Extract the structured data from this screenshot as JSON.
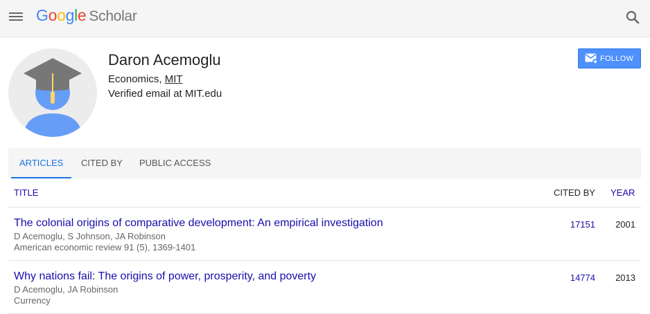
{
  "header": {
    "logo_letters": [
      "G",
      "o",
      "o",
      "g",
      "l",
      "e"
    ],
    "product": "Scholar",
    "menu_icon": "hamburger-menu-icon",
    "search_icon": "search-icon"
  },
  "profile": {
    "name": "Daron Acemoglu",
    "field": "Economics, ",
    "institution": "MIT",
    "verified_email": "Verified email at MIT.edu",
    "avatar_icon": "graduate-avatar-icon",
    "follow_label": "FOLLOW",
    "follow_icon": "email-plus-icon"
  },
  "tabs": [
    {
      "label": "ARTICLES",
      "active": true
    },
    {
      "label": "CITED BY",
      "active": false
    },
    {
      "label": "PUBLIC ACCESS",
      "active": false
    }
  ],
  "table": {
    "headers": {
      "title": "TITLE",
      "cited_by": "CITED BY",
      "year": "YEAR"
    },
    "rows": [
      {
        "title": "The colonial origins of comparative development: An empirical investigation",
        "authors": "D Acemoglu, S Johnson, JA Robinson",
        "venue": "American economic review 91 (5), 1369-1401",
        "cited_by": "17151",
        "year": "2001"
      },
      {
        "title": "Why nations fail: The origins of power, prosperity, and poverty",
        "authors": "D Acemoglu, JA Robinson",
        "venue": "Currency",
        "cited_by": "14774",
        "year": "2013"
      }
    ]
  },
  "colors": {
    "link": "#1a0dab",
    "accent": "#1a73e8",
    "follow_button": "#4d90fe",
    "avatar_body": "#669df6",
    "cap": "#777777",
    "tassel": "#fdd663"
  }
}
